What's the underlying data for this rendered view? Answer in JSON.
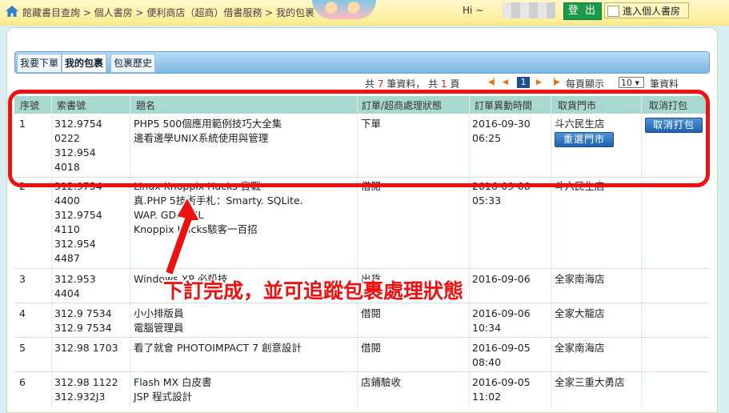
{
  "header": {
    "breadcrumb": "館藏書目查詢 > 個人書房 > 便利商店（超商）借書服務 > 我的包裹",
    "greeting": "Hi ~",
    "logout_label": "登 出",
    "enter_study_label": "進入個人書房"
  },
  "tabs": [
    {
      "label": "我要下單"
    },
    {
      "label": "我的包裹"
    },
    {
      "label": "包裹歷史"
    }
  ],
  "pagination": {
    "total_prefix": "共",
    "total_count": "7",
    "total_suffix": "筆資料，",
    "pages_prefix": "共",
    "pages_count": "1",
    "pages_suffix": "頁",
    "current_page": "1",
    "per_page_label": "每頁顯示",
    "per_page_value": "10 ▾",
    "per_page_suffix": "筆資料"
  },
  "table": {
    "headers": [
      "序號",
      "索書號",
      "題名",
      "訂單/超商處理狀態",
      "訂單異動時間",
      "取貨門市",
      "取消打包"
    ],
    "rows": [
      {
        "no": "1",
        "callnos": [
          "312.9754",
          "0222",
          "312.954",
          "4018"
        ],
        "titles": [
          "PHP5 500個應用範例技巧大全集",
          "邊看邊學UNIX系統使用與管理"
        ],
        "status": "下單",
        "time": [
          "2016-09-30",
          "06:25"
        ],
        "store": "斗六民生店",
        "reselect_label": "重選門市",
        "cancel_label": "取消打包"
      },
      {
        "no": "2",
        "callnos": [
          "312.9754",
          "4400",
          "312.9754",
          "4110",
          "312.954",
          "4487"
        ],
        "titles": [
          "Linux Knoppix Hacks 實戰",
          "真.PHP 5技術手札：Smarty. SQLite.",
          "WAP. GD. XML",
          "Knoppix Hacks駭客一百招"
        ],
        "status": "借閱",
        "time": [
          "2016-09-08",
          "05:33"
        ],
        "store": "斗六民生店"
      },
      {
        "no": "3",
        "callnos": [
          "312.953",
          "4404"
        ],
        "titles": [
          "Windows XP 必殺技"
        ],
        "status": "出貨",
        "time": [
          "2016-09-06",
          ""
        ],
        "store": "全家南海店"
      },
      {
        "no": "4",
        "callnos": [
          "312.9 7534",
          "312.9 7534"
        ],
        "titles": [
          "小小排版員",
          "電腦管理員"
        ],
        "status": "借閱",
        "time": [
          "2016-09-06",
          "10:34"
        ],
        "store": "全家大龍店"
      },
      {
        "no": "5",
        "callnos": [
          "312.98 1703"
        ],
        "titles": [
          "看了就會 PHOTOIMPACT 7 創意設計"
        ],
        "status": "借閱",
        "time": [
          "2016-09-05",
          "08:40"
        ],
        "store": "全家南海店"
      },
      {
        "no": "6",
        "callnos": [
          "312.98 1122",
          "312.932J3"
        ],
        "titles": [
          "Flash MX 白皮書",
          "JSP 程式設計"
        ],
        "status": "店鋪驗收",
        "time": [
          "2016-09-05",
          "11:02"
        ],
        "store": "全家三重大勇店"
      }
    ]
  },
  "annotation": {
    "text": "下訂完成，並可追蹤包裹處理狀態",
    "color": "#ee1111"
  },
  "colors": {
    "header_row": "#a8d8d0",
    "tab_bar": "#7fb7e3",
    "button_blue": "#1f62b0",
    "logout_green": "#1a9b4a"
  }
}
